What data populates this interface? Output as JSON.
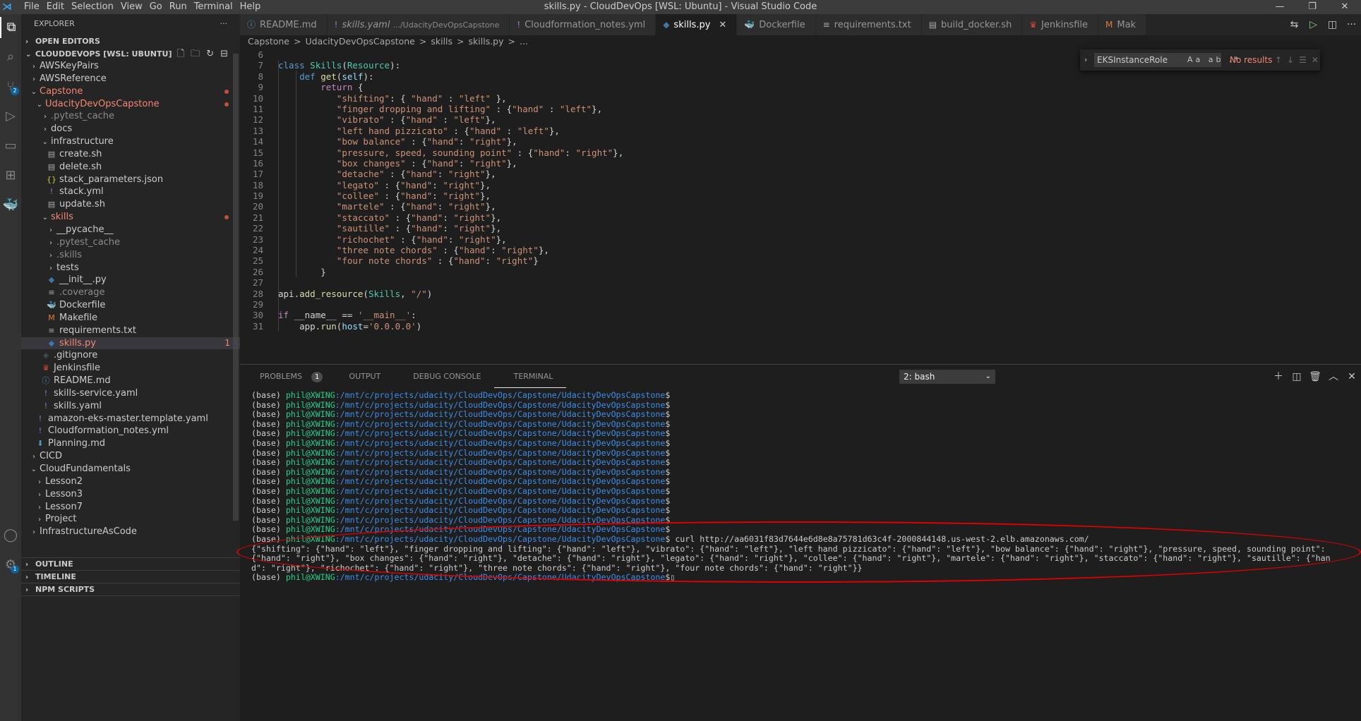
{
  "window": {
    "title": "skills.py - CloudDevOps [WSL: Ubuntu] - Visual Studio Code",
    "menus": [
      "File",
      "Edit",
      "Selection",
      "View",
      "Go",
      "Run",
      "Terminal",
      "Help"
    ]
  },
  "sidebar": {
    "title": "EXPLORER",
    "open_editors": "OPEN EDITORS",
    "root": "CLOUDDEVOPS [WSL: UBUNTU]",
    "tree": [
      {
        "depth": 0,
        "kind": "folder",
        "open": false,
        "label": "AWSKeyPairs"
      },
      {
        "depth": 0,
        "kind": "folder",
        "open": false,
        "label": "AWSReference"
      },
      {
        "depth": 0,
        "kind": "folder",
        "open": true,
        "label": "Capstone",
        "modified": true
      },
      {
        "depth": 1,
        "kind": "folder",
        "open": true,
        "label": "UdacityDevOpsCapstone",
        "modified": true
      },
      {
        "depth": 2,
        "kind": "folder",
        "open": false,
        "label": ".pytest_cache",
        "dim": true
      },
      {
        "depth": 2,
        "kind": "folder",
        "open": false,
        "label": "docs"
      },
      {
        "depth": 2,
        "kind": "folder",
        "open": true,
        "label": "infrastructure"
      },
      {
        "depth": 3,
        "kind": "file",
        "icon": "shell",
        "label": "create.sh"
      },
      {
        "depth": 3,
        "kind": "file",
        "icon": "shell",
        "label": "delete.sh"
      },
      {
        "depth": 3,
        "kind": "file",
        "icon": "json",
        "label": "stack_parameters.json"
      },
      {
        "depth": 3,
        "kind": "file",
        "icon": "yaml",
        "label": "stack.yml"
      },
      {
        "depth": 3,
        "kind": "file",
        "icon": "shell",
        "label": "update.sh"
      },
      {
        "depth": 2,
        "kind": "folder",
        "open": true,
        "label": "skills",
        "modified": true
      },
      {
        "depth": 3,
        "kind": "folder",
        "open": false,
        "label": "__pycache__"
      },
      {
        "depth": 3,
        "kind": "folder",
        "open": false,
        "label": ".pytest_cache",
        "dim": true
      },
      {
        "depth": 3,
        "kind": "folder",
        "open": false,
        "label": ".skills",
        "dim": true
      },
      {
        "depth": 3,
        "kind": "folder",
        "open": false,
        "label": "tests"
      },
      {
        "depth": 3,
        "kind": "file",
        "icon": "python",
        "label": "__init__.py"
      },
      {
        "depth": 3,
        "kind": "file",
        "icon": "text",
        "label": ".coverage",
        "dim": true
      },
      {
        "depth": 3,
        "kind": "file",
        "icon": "docker",
        "label": "Dockerfile"
      },
      {
        "depth": 3,
        "kind": "file",
        "icon": "make",
        "label": "Makefile"
      },
      {
        "depth": 3,
        "kind": "file",
        "icon": "text",
        "label": "requirements.txt"
      },
      {
        "depth": 3,
        "kind": "file",
        "icon": "python",
        "label": "skills.py",
        "selected": true,
        "problems": "1"
      },
      {
        "depth": 2,
        "kind": "file",
        "icon": "git",
        "label": ".gitignore"
      },
      {
        "depth": 2,
        "kind": "file",
        "icon": "jenkins",
        "label": "Jenkinsfile"
      },
      {
        "depth": 2,
        "kind": "file",
        "icon": "info",
        "label": "README.md"
      },
      {
        "depth": 2,
        "kind": "file",
        "icon": "yaml",
        "label": "skills-service.yaml"
      },
      {
        "depth": 2,
        "kind": "file",
        "icon": "yaml",
        "label": "skills.yaml"
      },
      {
        "depth": 1,
        "kind": "file",
        "icon": "yaml",
        "label": "amazon-eks-master.template.yaml"
      },
      {
        "depth": 1,
        "kind": "file",
        "icon": "yaml",
        "label": "Cloudformation_notes.yml"
      },
      {
        "depth": 1,
        "kind": "file",
        "icon": "markdown",
        "label": "Planning.md"
      },
      {
        "depth": 0,
        "kind": "folder",
        "open": false,
        "label": "CICD"
      },
      {
        "depth": 0,
        "kind": "folder",
        "open": true,
        "label": "CloudFundamentals"
      },
      {
        "depth": 1,
        "kind": "folder",
        "open": false,
        "label": "Lesson2"
      },
      {
        "depth": 1,
        "kind": "folder",
        "open": false,
        "label": "Lesson3"
      },
      {
        "depth": 1,
        "kind": "folder",
        "open": false,
        "label": "Lesson7"
      },
      {
        "depth": 1,
        "kind": "folder",
        "open": false,
        "label": "Project"
      },
      {
        "depth": 0,
        "kind": "folder",
        "open": false,
        "label": "InfrastructureAsCode"
      }
    ],
    "bottom_sections": [
      "OUTLINE",
      "TIMELINE",
      "NPM SCRIPTS"
    ]
  },
  "tabs": [
    {
      "label": "README.md",
      "icon": "info"
    },
    {
      "label": "skills.yaml",
      "suffix": ".../UdacityDevOpsCapstone",
      "icon": "yaml",
      "italic": true
    },
    {
      "label": "Cloudformation_notes.yml",
      "icon": "yaml"
    },
    {
      "label": "skills.py",
      "icon": "python",
      "active": true
    },
    {
      "label": "Dockerfile",
      "icon": "docker"
    },
    {
      "label": "requirements.txt",
      "icon": "text"
    },
    {
      "label": "build_docker.sh",
      "icon": "shell"
    },
    {
      "label": "Jenkinsfile",
      "icon": "jenkins"
    },
    {
      "label": "Mak",
      "icon": "make"
    }
  ],
  "breadcrumb": [
    "Capstone",
    ">",
    "UdacityDevOpsCapstone",
    ">",
    "skills",
    ">",
    "skills.py",
    ">",
    "..."
  ],
  "find": {
    "value": "EKSInstanceRole",
    "result": "No results"
  },
  "code": [
    {
      "n": "6",
      "t": ""
    },
    {
      "n": "7",
      "t": "class Skills(Resource):"
    },
    {
      "n": "8",
      "t": "    def get(self):"
    },
    {
      "n": "9",
      "t": "        return {"
    },
    {
      "n": "10",
      "t": "           \"shifting\": { \"hand\" : \"left\" },"
    },
    {
      "n": "11",
      "t": "           \"finger dropping and lifting\" : {\"hand\" : \"left\"},"
    },
    {
      "n": "12",
      "t": "           \"vibrato\" : {\"hand\" : \"left\"},"
    },
    {
      "n": "13",
      "t": "           \"left hand pizzicato\" : {\"hand\" : \"left\"},"
    },
    {
      "n": "14",
      "t": "           \"bow balance\" : {\"hand\": \"right\"},"
    },
    {
      "n": "15",
      "t": "           \"pressure, speed, sounding point\" : {\"hand\": \"right\"},"
    },
    {
      "n": "16",
      "t": "           \"box changes\" : {\"hand\": \"right\"},"
    },
    {
      "n": "17",
      "t": "           \"detache\" : {\"hand\": \"right\"},"
    },
    {
      "n": "18",
      "t": "           \"legato\" : {\"hand\": \"right\"},"
    },
    {
      "n": "19",
      "t": "           \"collee\" : {\"hand\": \"right\"},"
    },
    {
      "n": "20",
      "t": "           \"martele\" : {\"hand\": \"right\"},"
    },
    {
      "n": "21",
      "t": "           \"staccato\" : {\"hand\": \"right\"},"
    },
    {
      "n": "22",
      "t": "           \"sautille\" : {\"hand\": \"right\"},"
    },
    {
      "n": "23",
      "t": "           \"richochet\" : {\"hand\": \"right\"},"
    },
    {
      "n": "24",
      "t": "           \"three note chords\" : {\"hand\": \"right\"},"
    },
    {
      "n": "25",
      "t": "           \"four note chords\" : {\"hand\": \"right\"}"
    },
    {
      "n": "26",
      "t": "        }"
    },
    {
      "n": "27",
      "t": ""
    },
    {
      "n": "28",
      "t": "api.add_resource(Skills, \"/\")"
    },
    {
      "n": "29",
      "t": ""
    },
    {
      "n": "30",
      "t": "if __name__ == '__main__':"
    },
    {
      "n": "31",
      "t": "    app.run(host='0.0.0.0')"
    }
  ],
  "panel": {
    "tabs": [
      "PROBLEMS",
      "OUTPUT",
      "DEBUG CONSOLE",
      "TERMINAL"
    ],
    "problems_count": "1",
    "terminal_select": "2: bash",
    "prompt_prefix": "(base) ",
    "prompt_user": "phil@XWING",
    "prompt_path": ":/mnt/c/projects/udacity/CloudDevOps/Capstone/UdacityDevOpsCapstone",
    "prompt_end": "$",
    "empty_prompts": 15,
    "command": " curl http://aa6031f83d7644e6d8e8a75781d63c4f-2000844148.us-west-2.elb.amazonaws.com/",
    "output": "{\"shifting\": {\"hand\": \"left\"}, \"finger dropping and lifting\": {\"hand\": \"left\"}, \"vibrato\": {\"hand\": \"left\"}, \"left hand pizzicato\": {\"hand\": \"left\"}, \"bow balance\": {\"hand\": \"right\"}, \"pressure, speed, sounding point\": {\"hand\": \"right\"}, \"box changes\": {\"hand\": \"right\"}, \"detache\": {\"hand\": \"right\"}, \"legato\": {\"hand\": \"right\"}, \"collee\": {\"hand\": \"right\"}, \"martele\": {\"hand\": \"right\"}, \"staccato\": {\"hand\": \"right\"}, \"sautille\": {\"hand\": \"right\"}, \"richochet\": {\"hand\": \"right\"}, \"three note chords\": {\"hand\": \"right\"}, \"four note chords\": {\"hand\": \"right\"}}"
  },
  "colors": {
    "accent": "#007acc",
    "annotation": "#e00000",
    "prompt_green": "#23d18b",
    "prompt_blue": "#3b8eea"
  }
}
